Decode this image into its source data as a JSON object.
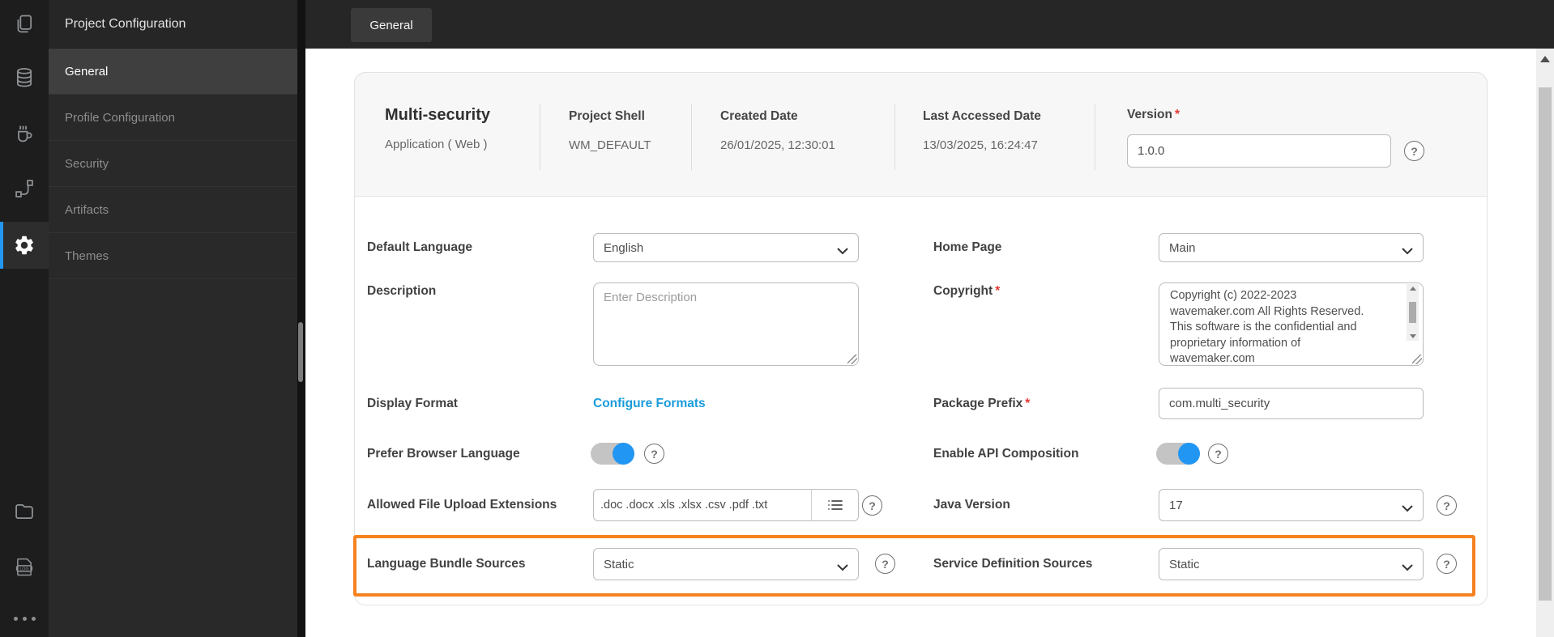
{
  "ui": {
    "required_marker": "*",
    "help_glyph": "?",
    "log_badge": "LOG"
  },
  "colors": {
    "accent_orange": "#F5821F",
    "primary_blue": "#2196F3",
    "link_blue": "#1B9CDB"
  },
  "sidebar": {
    "title": "Project Configuration",
    "items": [
      "General",
      "Profile Configuration",
      "Security",
      "Artifacts",
      "Themes"
    ],
    "active_item": "General"
  },
  "topbar": {
    "tab": "General"
  },
  "project": {
    "name": "Multi-security",
    "type": "Application ( Web )",
    "meta": [
      {
        "label": "Project Shell",
        "value": "WM_DEFAULT"
      },
      {
        "label": "Created Date",
        "value": "26/01/2025, 12:30:01"
      },
      {
        "label": "Last Accessed Date",
        "value": "13/03/2025, 16:24:47"
      }
    ],
    "version": {
      "label": "Version",
      "value": "1.0.0"
    }
  },
  "form": {
    "default_language": {
      "label": "Default Language",
      "value": "English"
    },
    "home_page": {
      "label": "Home Page",
      "value": "Main"
    },
    "description": {
      "label": "Description",
      "placeholder": "Enter Description"
    },
    "copyright": {
      "label": "Copyright",
      "value": "Copyright (c) 2022-2023\nwavemaker.com All Rights Reserved.\n This software is the confidential and\nproprietary information of\nwavemaker.com"
    },
    "display_format": {
      "label": "Display Format",
      "link": "Configure Formats"
    },
    "package_prefix": {
      "label": "Package Prefix",
      "value": "com.multi_security"
    },
    "prefer_browser_language": {
      "label": "Prefer Browser Language",
      "enabled": true
    },
    "enable_api_composition": {
      "label": "Enable API Composition",
      "enabled": true
    },
    "allowed_file_upload_extensions": {
      "label": "Allowed File Upload Extensions",
      "value": ".doc .docx .xls .xlsx .csv .pdf .txt"
    },
    "java_version": {
      "label": "Java Version",
      "value": "17"
    },
    "language_bundle_sources": {
      "label": "Language Bundle Sources",
      "value": "Static"
    },
    "service_definition_sources": {
      "label": "Service Definition Sources",
      "value": "Static"
    }
  }
}
